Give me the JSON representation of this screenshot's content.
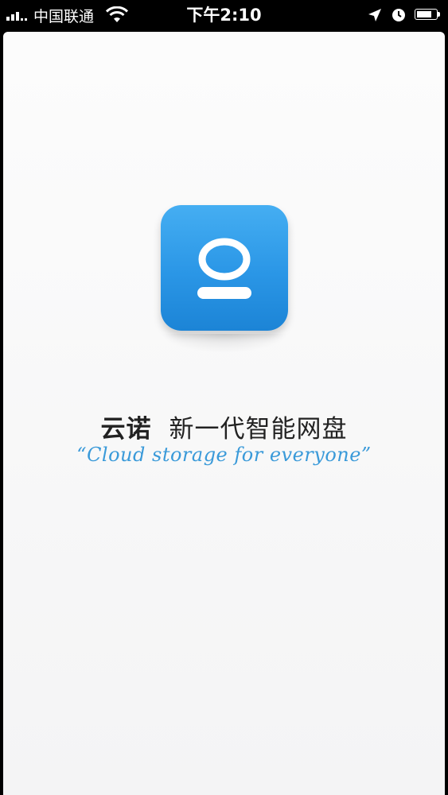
{
  "status_bar": {
    "carrier": "中国联通",
    "time": "下午2:10",
    "signal_bars": 3,
    "battery_level": 0.8,
    "icons": [
      "signal-icon",
      "wifi-icon",
      "location-arrow-icon",
      "alarm-clock-icon",
      "battery-icon"
    ]
  },
  "splash": {
    "app_icon": "yunnuo-logo-icon",
    "brand_name": "云诺",
    "slogan_cn": "新一代智能网盘",
    "slogan_en": "“Cloud storage for everyone”",
    "accent_color": "#2a96e6",
    "slogan_en_color": "#3a9ad9"
  }
}
